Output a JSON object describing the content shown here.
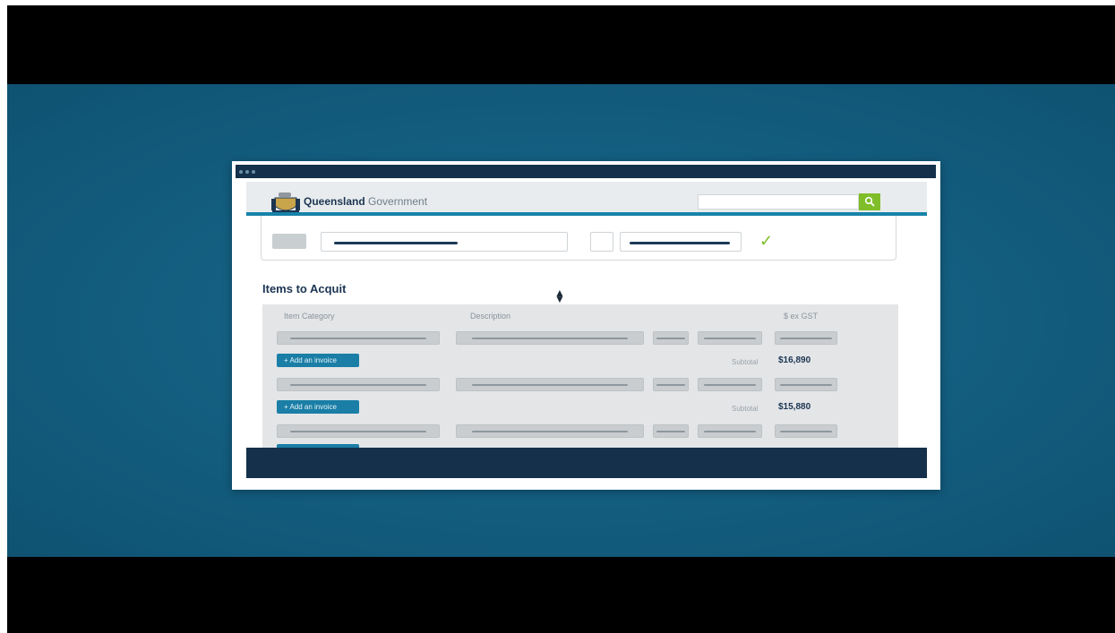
{
  "header": {
    "brand_bold": "Queensland",
    "brand_light": "Government",
    "search": {
      "placeholder": "",
      "button_icon": "search-icon"
    }
  },
  "form_status": {
    "confirm_icon": "checkmark-icon"
  },
  "section": {
    "title": "Items to Acquit",
    "sort_icon": "sort-arrows-icon"
  },
  "table": {
    "columns": [
      "Item Category",
      "Description",
      "$ ex GST"
    ],
    "groups": [
      {
        "add_label": "+ Add an invoice",
        "subtotal_label": "Subtotal",
        "subtotal_value": "$16,890"
      },
      {
        "add_label": "+ Add an invoice",
        "subtotal_label": "Subtotal",
        "subtotal_value": "$15,880"
      },
      {
        "add_label": "",
        "subtotal_label": "",
        "subtotal_value": ""
      }
    ]
  },
  "colors": {
    "backdrop": "#135d7f",
    "window_bar": "#14304a",
    "accent": "#1782a8",
    "search_button": "#7fbe2a",
    "add_button": "#1a7ea6"
  }
}
